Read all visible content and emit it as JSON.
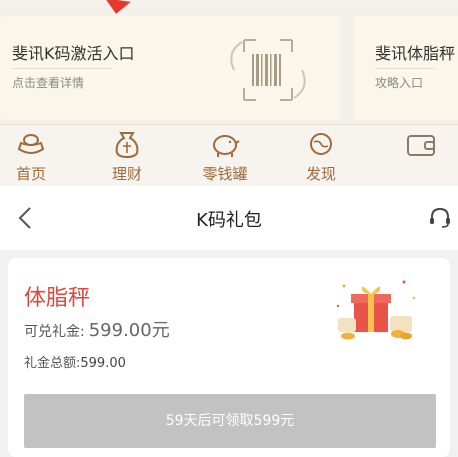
{
  "promo_cards": [
    {
      "title": "斐讯K码激活入口",
      "subtitle": "点击查看详情"
    },
    {
      "title": "斐讯体脂秤",
      "subtitle": "攻略入口"
    }
  ],
  "bottom_nav": [
    {
      "label": "首页",
      "icon": "ingot-icon"
    },
    {
      "label": "理财",
      "icon": "money-bag-icon"
    },
    {
      "label": "零钱罐",
      "icon": "piggy-bank-icon"
    },
    {
      "label": "发现",
      "icon": "planet-icon"
    },
    {
      "label": "",
      "icon": "wallet-icon"
    }
  ],
  "header": {
    "title": "K码礼包"
  },
  "gift_card": {
    "title": "体脂秤",
    "redeem_label": "可兑礼金:",
    "redeem_value": "599.00元",
    "total_label": "礼金总额:",
    "total_value": "599.00",
    "button_label": "59天后可领取599元"
  },
  "colors": {
    "accent_red": "#e0463c",
    "nav_brown": "#a06a3a",
    "button_disabled": "#c2c2c2"
  }
}
